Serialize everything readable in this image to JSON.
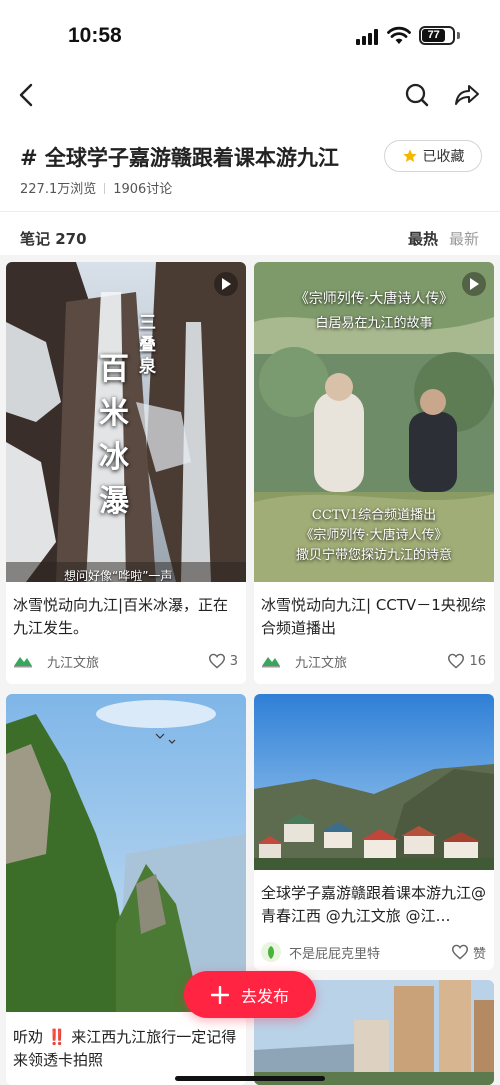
{
  "status_bar": {
    "time": "10:58",
    "battery": "77"
  },
  "nav": {
    "back_icon": "chevron-left-icon",
    "search_icon": "search-icon",
    "share_icon": "share-icon"
  },
  "topic": {
    "title": "# 全球学子嘉游赣跟着课本游九江",
    "views": "227.1万浏览",
    "discussions": "1906讨论",
    "collect_label": "已收藏",
    "collect_icon": "star-icon",
    "accent": "#f5b800"
  },
  "notes_bar": {
    "count_label": "笔记 270",
    "sort_hot": "最热",
    "sort_new": "最新"
  },
  "cards": [
    {
      "title": "冰雪悦动向九江|百米冰瀑，正在九江发生。",
      "author": "九江文旅",
      "likes": "3",
      "cover_text_vertical": "百米冰瀑",
      "cover_text_small": "三叠泉",
      "cover_caption": "想问好像“哗啦”一声"
    },
    {
      "title": "冰雪悦动向九江| CCTV－1央视综合频道播出",
      "author": "九江文旅",
      "likes": "16",
      "cover_banner_top": "《宗师列传·大唐诗人传》",
      "cover_banner_sub": "白居易在九江的故事",
      "cover_banner_bottom_1": "CCTV1综合频道播出",
      "cover_banner_bottom_2": "《宗师列传·大唐诗人传》",
      "cover_banner_bottom_3": "撒贝宁带您探访九江的诗意"
    },
    {
      "title": "听劝 ‼️ 来江西九江旅行一定记得来领透卡拍照",
      "author": "",
      "likes": ""
    },
    {
      "title": "全球学子嘉游赣跟着课本游九江@青春江西 @九江文旅 @江…",
      "author": "不是屁屁克里特",
      "likes": "赞"
    }
  ],
  "fab": {
    "label": "去发布"
  },
  "colors": {
    "brand_red": "#ff2442",
    "feed_bg": "#f4f4f4"
  }
}
